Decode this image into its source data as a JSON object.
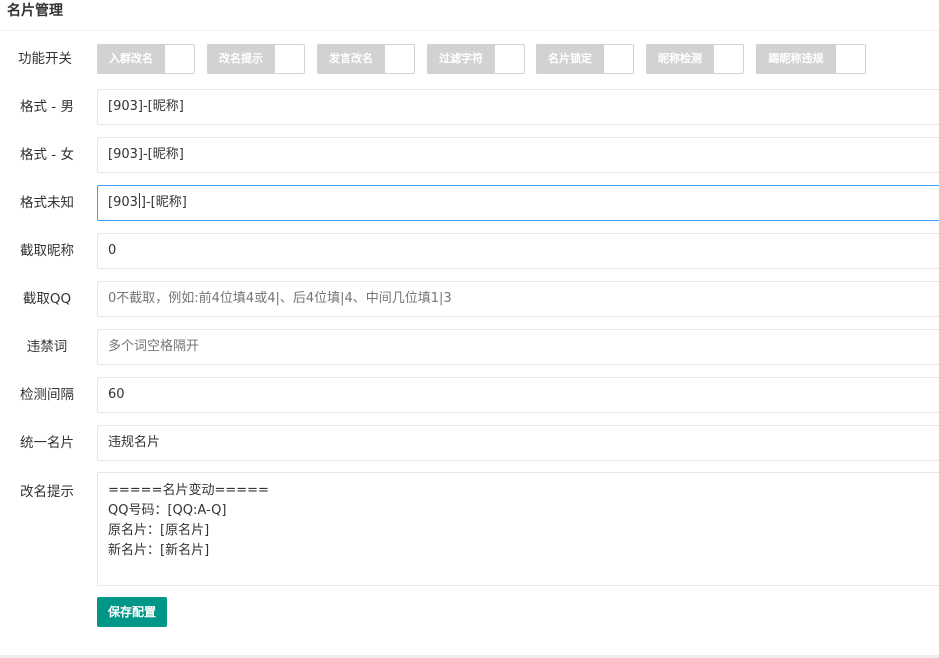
{
  "card": {
    "title": "名片管理"
  },
  "switches": {
    "label": "功能开关",
    "items": [
      {
        "label": "入群改名"
      },
      {
        "label": "改名提示"
      },
      {
        "label": "发言改名"
      },
      {
        "label": "过滤字符"
      },
      {
        "label": "名片锁定"
      },
      {
        "label": "昵称检测"
      },
      {
        "label": "踢昵称违规"
      }
    ]
  },
  "fields": {
    "format_male": {
      "label": "格式 - 男",
      "value": "[903]-[昵称]"
    },
    "format_female": {
      "label": "格式 - 女",
      "value": "[903]-[昵称]"
    },
    "format_unknown": {
      "label": "格式未知",
      "value_before_caret": "[903",
      "value_after_caret": "]-[昵称]"
    },
    "truncate_nickname": {
      "label": "截取昵称",
      "value": "0"
    },
    "truncate_qq": {
      "label": "截取QQ",
      "placeholder": "0不截取，例如:前4位填4或4|、后4位填|4、中间几位填1|3"
    },
    "banned_words": {
      "label": "违禁词",
      "placeholder": "多个词空格隔开"
    },
    "check_interval": {
      "label": "检测间隔",
      "value": "60"
    },
    "unified_card": {
      "label": "统一名片",
      "value": "违规名片"
    },
    "rename_notice": {
      "label": "改名提示",
      "lines": [
        "=====名片变动=====",
        "QQ号码：[QQ:A-Q]",
        "原名片：[原名片]",
        "新名片：[新名片]"
      ]
    }
  },
  "actions": {
    "save_label": "保存配置"
  },
  "colors": {
    "accent": "#009688",
    "focus_border": "#409eff",
    "switch_off": "#d2d2d2"
  }
}
